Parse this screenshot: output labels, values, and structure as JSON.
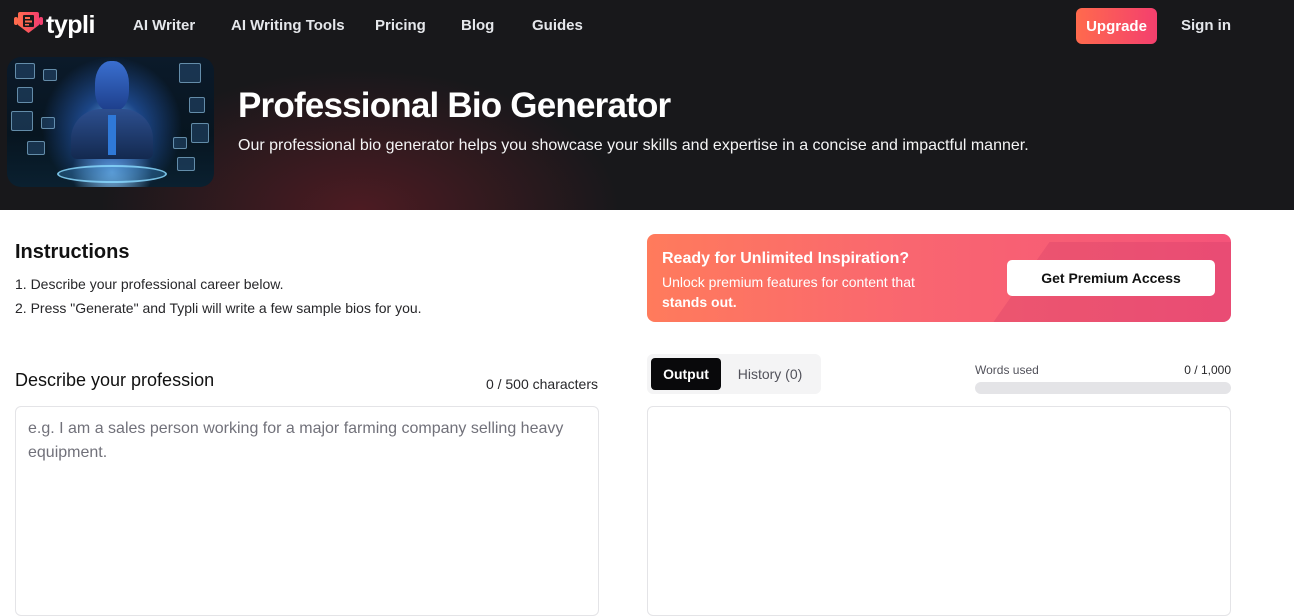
{
  "brand": {
    "name": "typli",
    "accent": "#f43f6e"
  },
  "nav": {
    "links": [
      "AI Writer",
      "AI Writing Tools",
      "Pricing",
      "Blog",
      "Guides"
    ],
    "upgrade_label": "Upgrade",
    "signin_label": "Sign in"
  },
  "hero": {
    "image_alt": "AI robot in business suit with holographic icons",
    "title": "Professional Bio Generator",
    "subtitle": "Our professional bio generator helps you showcase your skills and expertise in a concise and impactful manner."
  },
  "instructions": {
    "title": "Instructions",
    "items": [
      "1. Describe your professional career below.",
      "2. Press \"Generate\" and Typli will write a few sample bios for you."
    ]
  },
  "promo": {
    "title": "Ready for Unlimited Inspiration?",
    "desc_prefix": "Unlock premium features for content that ",
    "desc_bold": "stands out.",
    "button_label": "Get Premium Access"
  },
  "input": {
    "label": "Describe your profession",
    "char_count": "0 / 500 characters",
    "value": "",
    "placeholder": "e.g. I am a sales person working for a major farming company selling heavy equipment."
  },
  "output": {
    "tabs": [
      {
        "label": "Output",
        "active": true
      },
      {
        "label": "History (0)",
        "active": false
      }
    ],
    "words_label": "Words used",
    "words_count": "0 / 1,000",
    "words_used_fraction": 0
  }
}
